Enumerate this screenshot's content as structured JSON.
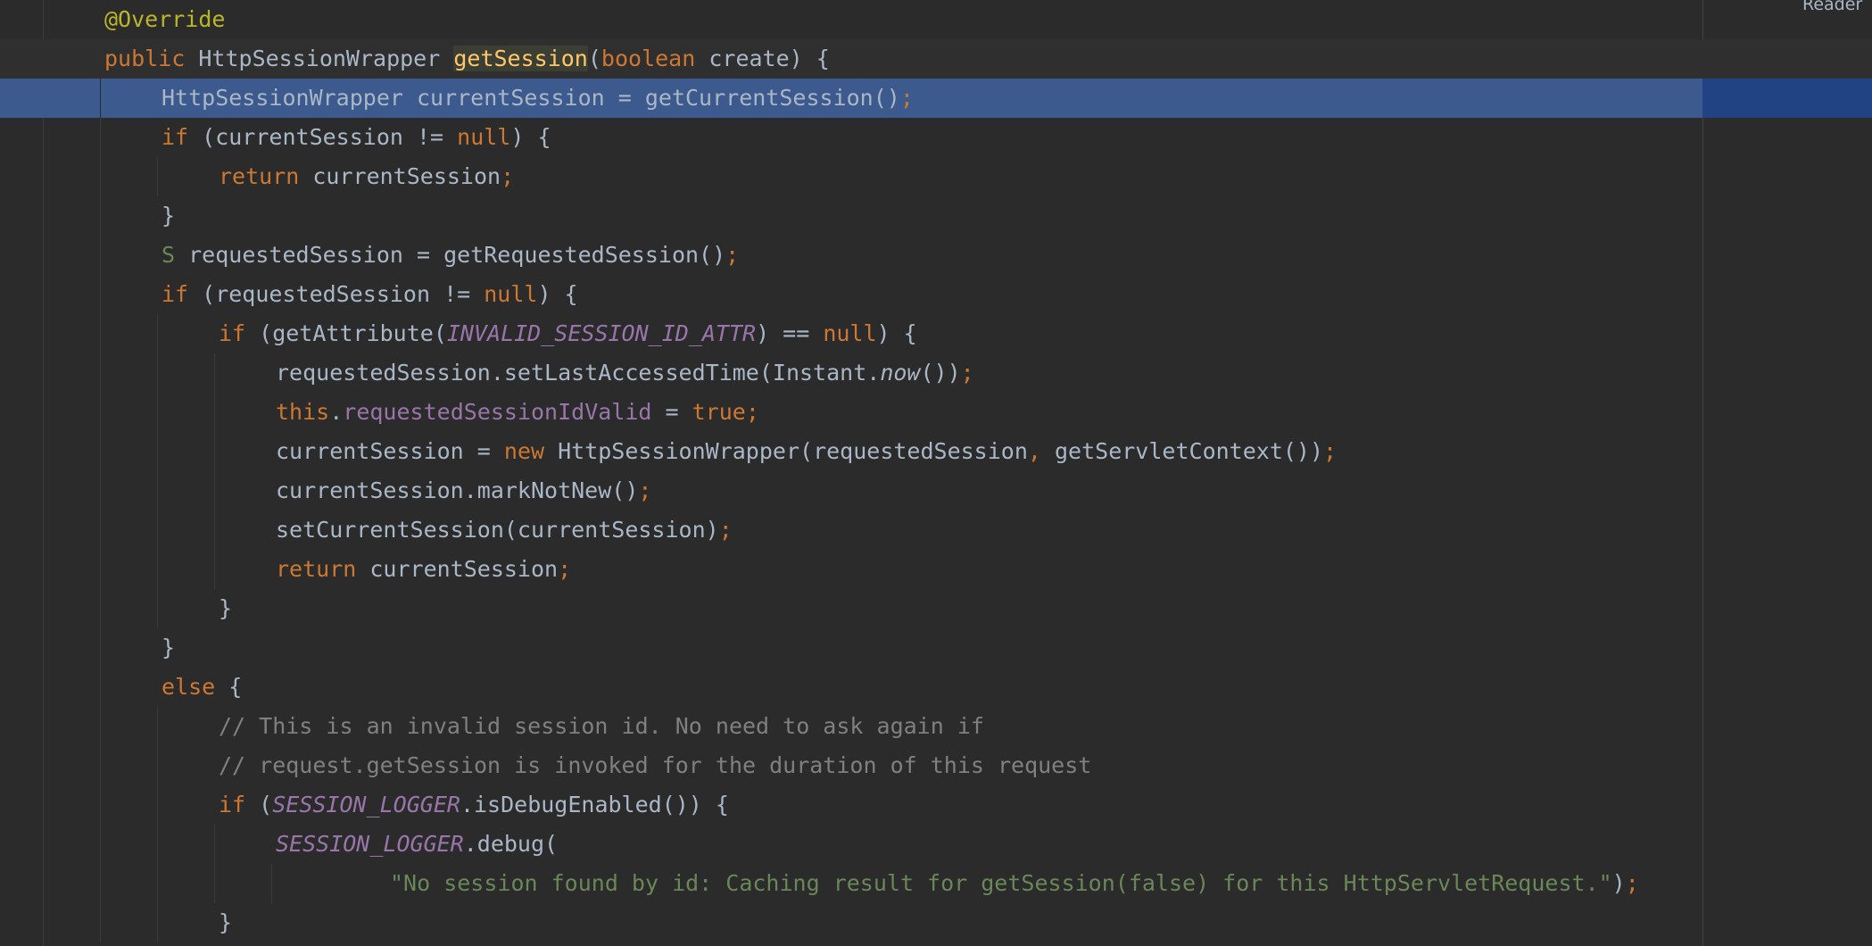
{
  "editor": {
    "reader_mode_label": "Reader",
    "lines": [
      {
        "tokens": [
          [
            "ann",
            "@Override"
          ]
        ]
      },
      {
        "tokens": [
          [
            "kw",
            "public "
          ],
          [
            "",
            "HttpSessionWrapper "
          ],
          [
            "fn-hl",
            "getSession"
          ],
          [
            "",
            "("
          ],
          [
            "kw",
            "boolean "
          ],
          [
            "",
            "create) {"
          ]
        ]
      },
      {
        "tokens": [
          [
            "",
            "HttpSessionWrapper currentSession = getCurrentSession()"
          ],
          [
            "sem",
            ";"
          ]
        ]
      },
      {
        "tokens": [
          [
            "kw",
            "if "
          ],
          [
            "",
            "(currentSession != "
          ],
          [
            "kw",
            "null"
          ],
          [
            "",
            ") {"
          ]
        ]
      },
      {
        "tokens": [
          [
            "kw",
            "return "
          ],
          [
            "",
            "currentSession"
          ],
          [
            "sem",
            ";"
          ]
        ]
      },
      {
        "tokens": [
          [
            "",
            "}"
          ]
        ]
      },
      {
        "tokens": [
          [
            "svar",
            "S "
          ],
          [
            "",
            "requestedSession = getRequestedSession()"
          ],
          [
            "sem",
            ";"
          ]
        ]
      },
      {
        "tokens": [
          [
            "kw",
            "if "
          ],
          [
            "",
            "(requestedSession != "
          ],
          [
            "kw",
            "null"
          ],
          [
            "",
            ") {"
          ]
        ]
      },
      {
        "tokens": [
          [
            "kw",
            "if "
          ],
          [
            "",
            "(getAttribute("
          ],
          [
            "st",
            "INVALID_SESSION_ID_ATTR"
          ],
          [
            "",
            ") == "
          ],
          [
            "kw",
            "null"
          ],
          [
            "",
            ") {"
          ]
        ]
      },
      {
        "tokens": [
          [
            "",
            "requestedSession.setLastAccessedTime(Instant."
          ],
          [
            "it",
            "now"
          ],
          [
            "",
            "())"
          ],
          [
            "sem",
            ";"
          ]
        ]
      },
      {
        "tokens": [
          [
            "kw",
            "this"
          ],
          [
            "",
            "."
          ],
          [
            "fld",
            "requestedSessionIdValid"
          ],
          [
            "",
            " = "
          ],
          [
            "kw",
            "true"
          ],
          [
            "sem",
            ";"
          ]
        ]
      },
      {
        "tokens": [
          [
            "",
            "currentSession = "
          ],
          [
            "kw",
            "new "
          ],
          [
            "",
            "HttpSessionWrapper(requestedSession"
          ],
          [
            "sem",
            ", "
          ],
          [
            "",
            "getServletContext())"
          ],
          [
            "sem",
            ";"
          ]
        ]
      },
      {
        "tokens": [
          [
            "",
            "currentSession.markNotNew()"
          ],
          [
            "sem",
            ";"
          ]
        ]
      },
      {
        "tokens": [
          [
            "",
            "setCurrentSession(currentSession)"
          ],
          [
            "sem",
            ";"
          ]
        ]
      },
      {
        "tokens": [
          [
            "kw",
            "return "
          ],
          [
            "",
            "currentSession"
          ],
          [
            "sem",
            ";"
          ]
        ]
      },
      {
        "tokens": [
          [
            "",
            "}"
          ]
        ]
      },
      {
        "tokens": [
          [
            "",
            "}"
          ]
        ]
      },
      {
        "tokens": [
          [
            "kw",
            "else "
          ],
          [
            "",
            "{"
          ]
        ]
      },
      {
        "tokens": [
          [
            "cm",
            "// This is an invalid session id. No need to ask again if"
          ]
        ]
      },
      {
        "tokens": [
          [
            "cm",
            "// request.getSession is invoked for the duration of this request"
          ]
        ]
      },
      {
        "tokens": [
          [
            "kw",
            "if "
          ],
          [
            "",
            "("
          ],
          [
            "st",
            "SESSION_LOGGER"
          ],
          [
            "",
            ".isDebugEnabled()) {"
          ]
        ]
      },
      {
        "tokens": [
          [
            "st",
            "SESSION_LOGGER"
          ],
          [
            "",
            ".debug("
          ]
        ]
      },
      {
        "tokens": [
          [
            "str",
            "\"No session found by id: Caching result for getSession(false) for this HttpServletRequest.\""
          ],
          [
            "",
            ")"
          ],
          [
            "sem",
            ";"
          ]
        ]
      },
      {
        "tokens": [
          [
            "",
            "}"
          ]
        ]
      }
    ]
  }
}
